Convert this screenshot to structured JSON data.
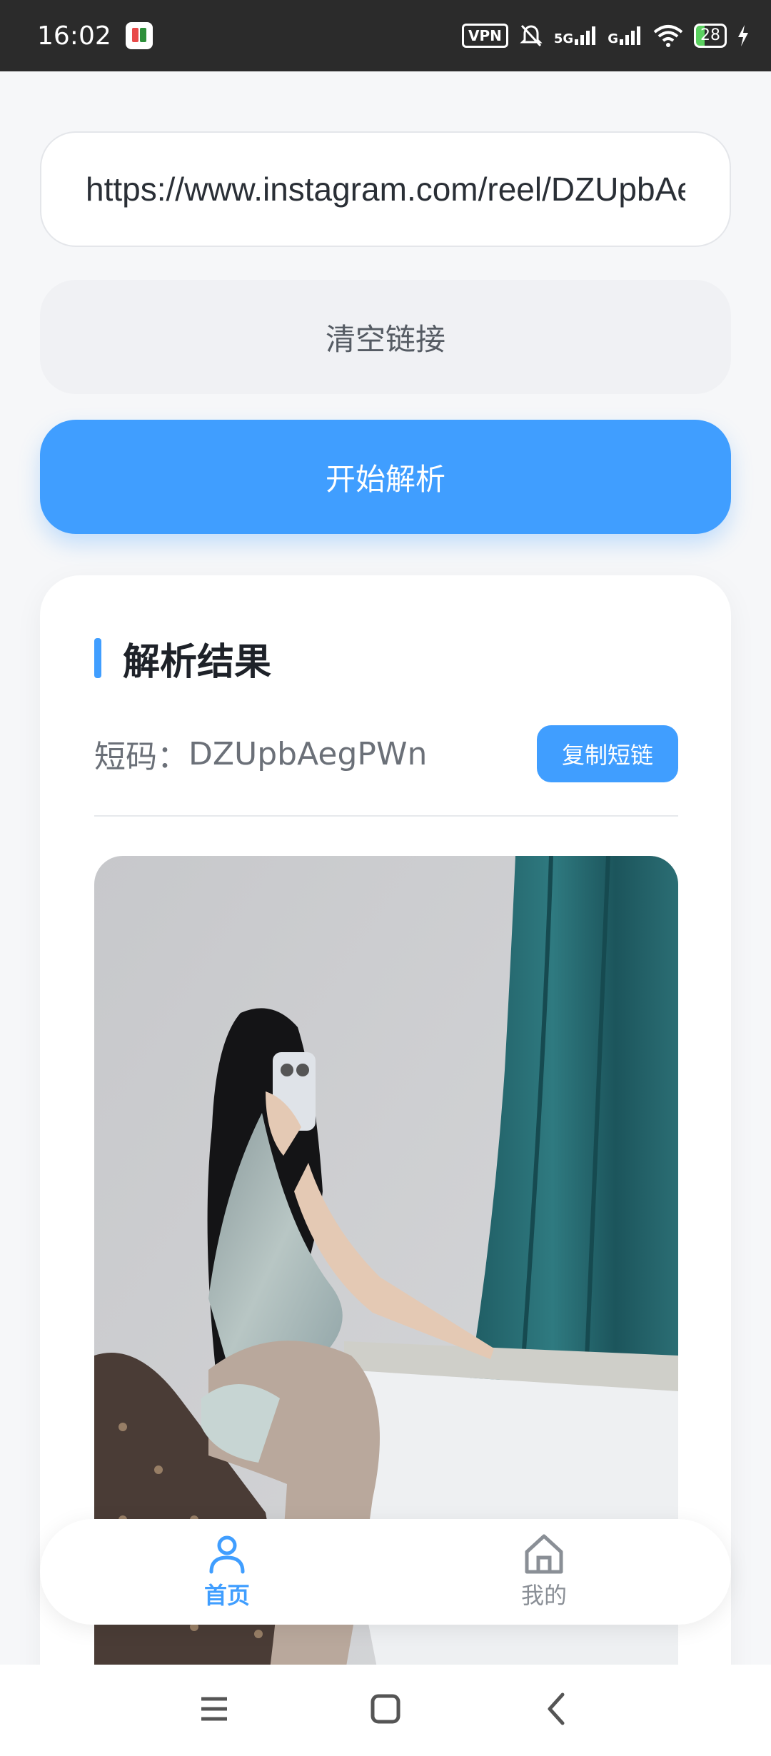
{
  "status_bar": {
    "time": "16:02",
    "vpn": "VPN",
    "signal_1": "5G",
    "signal_2": "G",
    "battery": "28",
    "icons": [
      "app-notification-icon",
      "vpn-icon",
      "mute-bell-icon",
      "signal-icon",
      "wifi-icon",
      "battery-icon",
      "charging-icon"
    ]
  },
  "url_input": {
    "value": "https://www.instagram.com/reel/DZUpbAegPWn"
  },
  "buttons": {
    "clear_label": "清空链接",
    "parse_label": "开始解析",
    "copy_label": "复制短链"
  },
  "result": {
    "title": "解析结果",
    "code_label": "短码：",
    "code_value": "DZUpbAegPWn"
  },
  "tabbar": {
    "home_label": "首页",
    "mine_label": "我的",
    "active": "home"
  },
  "colors": {
    "accent": "#409eff",
    "background": "#f6f7f9",
    "status_bar": "#2b2b2b"
  }
}
